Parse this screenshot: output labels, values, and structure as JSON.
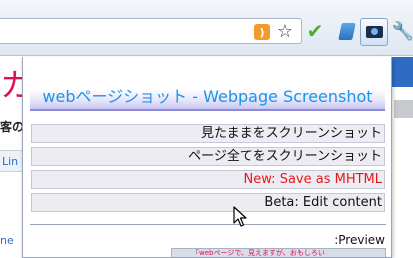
{
  "toolbar": {
    "rss_glyph": "⌕",
    "star_glyph": "☆",
    "check_glyph": "✔",
    "wrench_glyph": "🔧"
  },
  "background_page": {
    "red_char": "カ",
    "black_char": "客の",
    "link_text": "Lin",
    "blue_text": "ne"
  },
  "popup": {
    "title": "webページショット - Webpage Screenshot",
    "menu": [
      "見たままをスクリーンショット",
      "ページ全てをスクリーンショット",
      "New: Save as MHTML",
      "Beta: Edit content"
    ],
    "preview_label": ":Preview",
    "preview_thumb_text": "「webページで、見えますが、おもしろい"
  },
  "colors": {
    "title": "#1c93e6",
    "accent_red": "#e81818",
    "header_border": "#8e8ad8"
  }
}
